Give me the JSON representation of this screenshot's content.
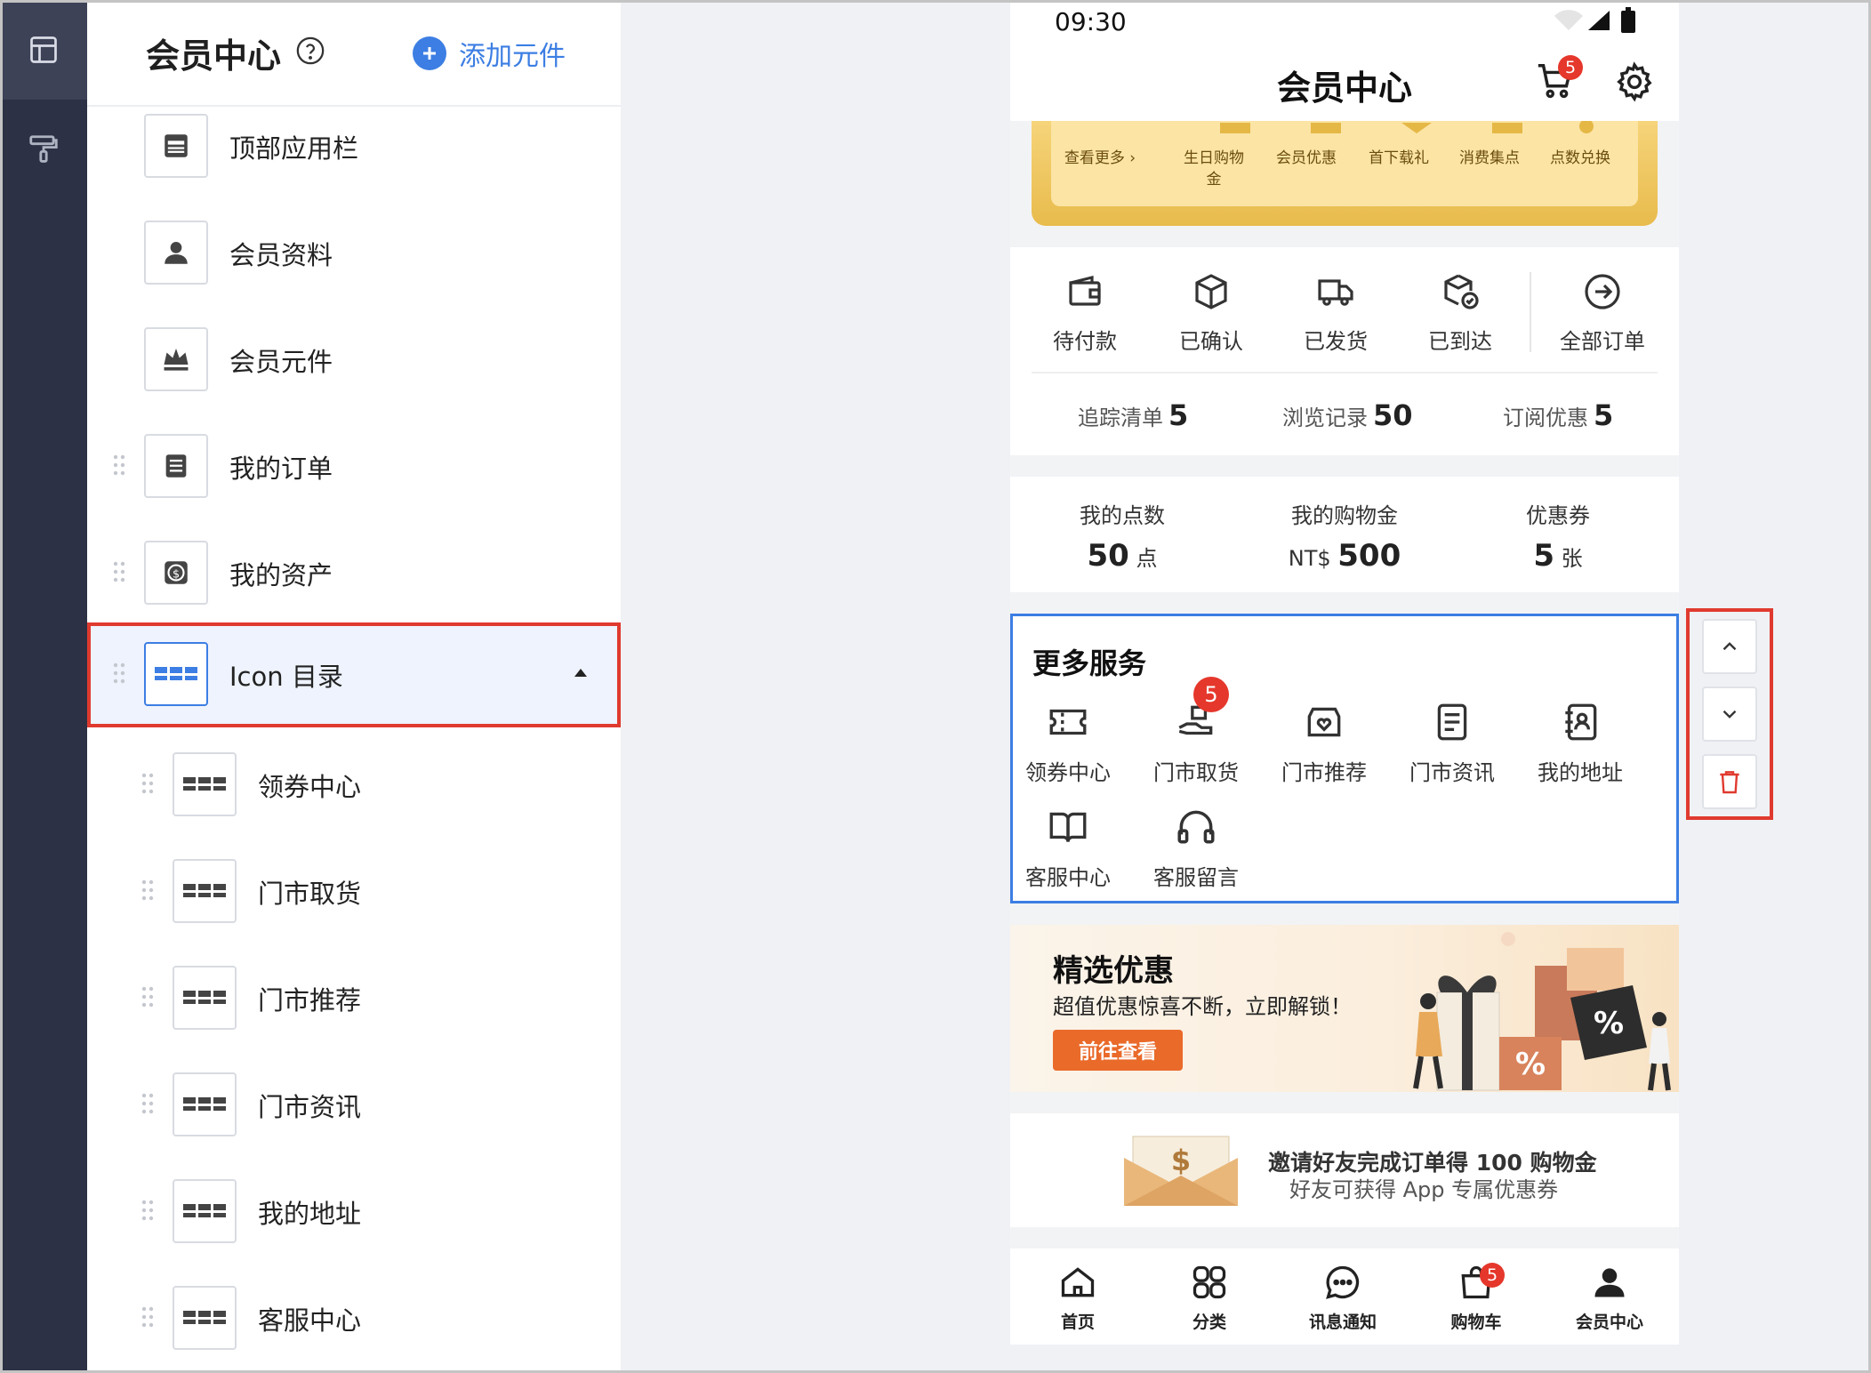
{
  "sidebar_rail": {
    "items": [
      {
        "icon": "layout-icon",
        "active": true
      },
      {
        "icon": "paint-roller-icon",
        "active": false
      }
    ]
  },
  "panel": {
    "title": "会员中心",
    "add_label": "添加元件",
    "items": [
      {
        "label": "顶部应用栏",
        "icon": "app-bar-icon"
      },
      {
        "label": "会员资料",
        "icon": "user-icon"
      },
      {
        "label": "会员元件",
        "icon": "crown-icon"
      },
      {
        "label": "我的订单",
        "icon": "list-icon"
      },
      {
        "label": "我的资产",
        "icon": "dollar-icon"
      },
      {
        "label": "Icon 目录",
        "icon": "grid-icon",
        "selected": true
      },
      {
        "label": "领券中心",
        "icon": "grid-icon"
      },
      {
        "label": "门市取货",
        "icon": "grid-icon"
      },
      {
        "label": "门市推荐",
        "icon": "grid-icon"
      },
      {
        "label": "门市资讯",
        "icon": "grid-icon"
      },
      {
        "label": "我的地址",
        "icon": "grid-icon"
      },
      {
        "label": "客服中心",
        "icon": "grid-icon"
      }
    ]
  },
  "phone": {
    "time": "09:30",
    "title": "会员中心",
    "cart_badge": "5",
    "perks": [
      "查看更多 ›",
      "生日购物金",
      "会员优惠",
      "首下载礼",
      "消费集点",
      "点数兑换"
    ],
    "orders": [
      "待付款",
      "已确认",
      "已发货",
      "已到达",
      "全部订单"
    ],
    "stats": [
      {
        "label": "追踪清单",
        "value": "5"
      },
      {
        "label": "浏览记录",
        "value": "50"
      },
      {
        "label": "订阅优惠",
        "value": "5"
      }
    ],
    "assets": [
      {
        "title": "我的点数",
        "value": "50",
        "unit": "点",
        "prefix": ""
      },
      {
        "title": "我的购物金",
        "value": "500",
        "unit": "",
        "prefix": "NT$"
      },
      {
        "title": "优惠券",
        "value": "5",
        "unit": "张",
        "prefix": ""
      }
    ],
    "services": {
      "title": "更多服务",
      "items": [
        {
          "label": "领券中心",
          "icon": "ticket-icon"
        },
        {
          "label": "门市取货",
          "icon": "hand-package-icon",
          "badge": "5"
        },
        {
          "label": "门市推荐",
          "icon": "store-heart-icon"
        },
        {
          "label": "门市资讯",
          "icon": "document-icon"
        },
        {
          "label": "我的地址",
          "icon": "address-book-icon"
        },
        {
          "label": "客服中心",
          "icon": "book-open-icon"
        },
        {
          "label": "客服留言",
          "icon": "headphones-icon"
        }
      ]
    },
    "banner": {
      "title": "精选优惠",
      "subtitle": "超值优惠惊喜不断，立即解锁！",
      "button": "前往查看"
    },
    "invite": {
      "line1": "邀请好友完成订单得 100 购物金",
      "line2": "好友可获得 App 专属优惠券"
    },
    "tabs": [
      {
        "label": "首页",
        "icon": "home-icon"
      },
      {
        "label": "分类",
        "icon": "category-icon"
      },
      {
        "label": "讯息通知",
        "icon": "chat-icon"
      },
      {
        "label": "购物车",
        "icon": "bag-icon",
        "badge": "5"
      },
      {
        "label": "会员中心",
        "icon": "person-icon"
      }
    ]
  },
  "colors": {
    "accent": "#3c7ee3",
    "highlight": "#e03a2f",
    "badge": "#e5372b",
    "gold": "#e8bb4c",
    "banner_button": "#ea6a2a"
  }
}
